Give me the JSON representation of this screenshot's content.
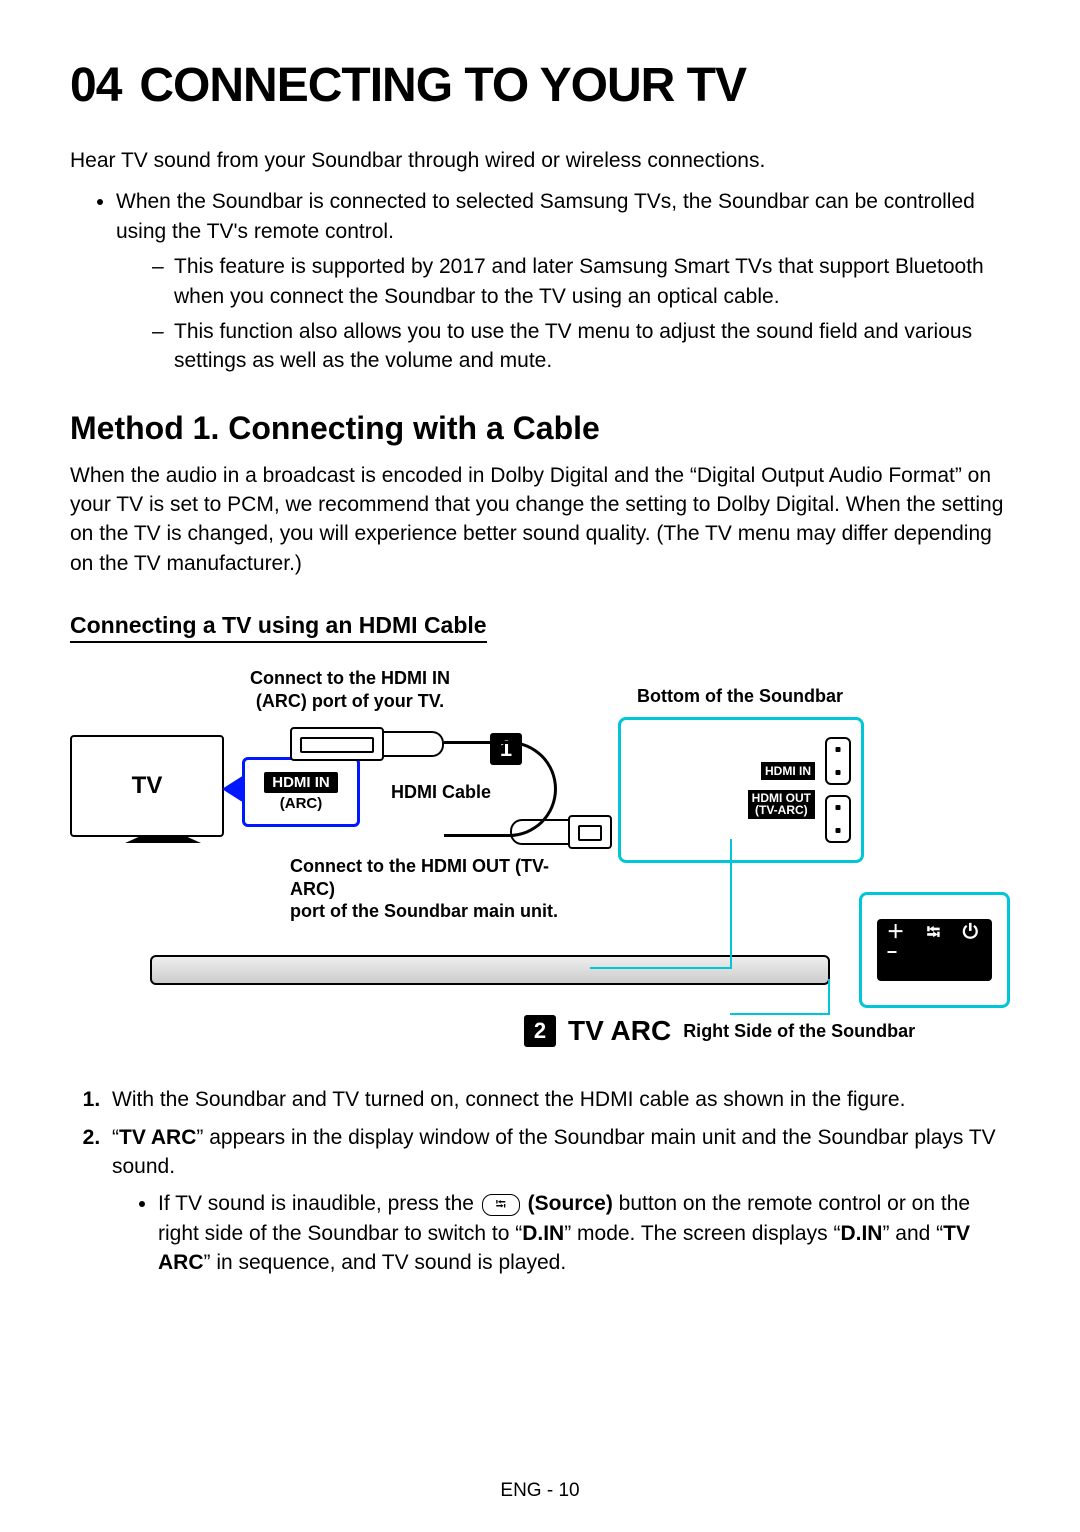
{
  "section_number": "04",
  "section_title": "CONNECTING TO YOUR TV",
  "intro": "Hear TV sound from your Soundbar through wired or wireless connections.",
  "bullets": {
    "b1": "When the Soundbar is connected to selected Samsung TVs, the Soundbar can be controlled using the TV's remote control.",
    "d1": "This feature is supported by 2017 and later Samsung Smart TVs that support Bluetooth when you connect the Soundbar to the TV using an optical cable.",
    "d2": "This function also allows you to use the TV menu to adjust the sound field and various settings as well as the volume and mute."
  },
  "method1_title": "Method 1. Connecting with a Cable",
  "method1_para": "When the audio in a broadcast is encoded in Dolby Digital and the “Digital Output Audio Format” on your TV is set to PCM, we recommend that you change the setting to Dolby Digital. When the setting on the TV is changed, you will experience better sound quality. (The TV menu may differ depending on the TV manufacturer.)",
  "sub_title": "Connecting a TV using an HDMI Cable",
  "diagram": {
    "tv_label": "TV",
    "connect_tv_label_line1": "Connect to the HDMI IN",
    "connect_tv_label_line2": "(ARC) port of your TV.",
    "bottom_soundbar_label": "Bottom of the Soundbar",
    "hdmi_in_label": "HDMI IN",
    "arc_label": "(ARC)",
    "hdmi_cable_label": "HDMI Cable",
    "connect_sb_label_line1": "Connect to the HDMI OUT (TV-ARC)",
    "connect_sb_label_line2": "port of the Soundbar main unit.",
    "port_hdmi_in": "HDMI IN",
    "port_hdmi_out_1": "HDMI OUT",
    "port_hdmi_out_2": "(TV-ARC)",
    "step1": "1",
    "step2": "2",
    "tv_arc": "TV ARC",
    "right_side_label": "Right Side of the Soundbar",
    "side_panel_glyphs": "＋  ⭾  ⏻\n−"
  },
  "steps": {
    "s1": "With the Soundbar and TV turned on, connect the HDMI cable as shown in the figure.",
    "s2_pre": "“",
    "s2_bold1": "TV ARC",
    "s2_mid": "” appears in the display window of the Soundbar main unit and the Soundbar plays TV sound.",
    "s2b_pre": "If TV sound is inaudible, press the ",
    "s2b_source": "(Source)",
    "s2b_mid1": " button on the remote control or on the right side of the Soundbar to switch to “",
    "s2b_bold2": "D.IN",
    "s2b_mid2": "” mode. The screen displays “",
    "s2b_bold3": "D.IN",
    "s2b_mid3": "” and “",
    "s2b_bold4": "TV ARC",
    "s2b_mid4": "” in sequence, and TV sound is played."
  },
  "footer": "ENG - 10"
}
